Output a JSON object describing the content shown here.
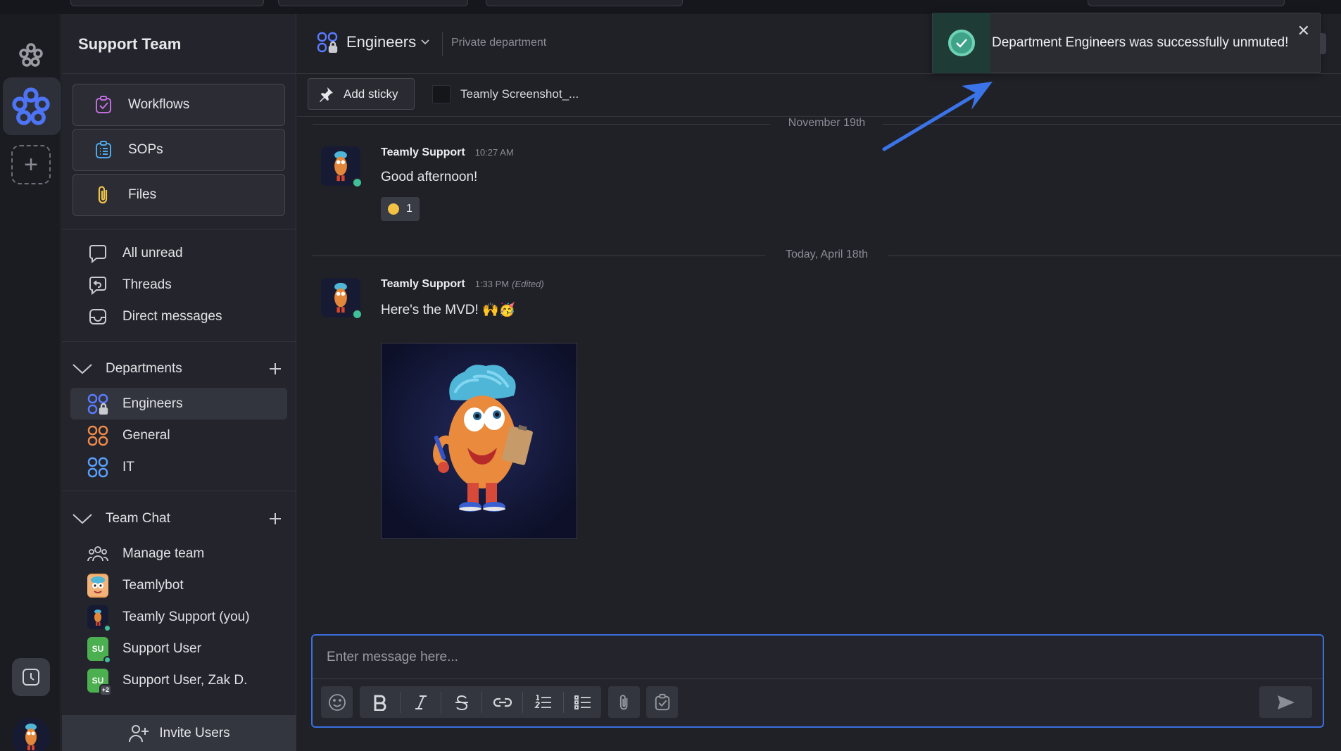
{
  "workspace": {
    "title": "Support Team"
  },
  "rail": {
    "logo_icon": "teamly-flower-icon",
    "active_icon": "teamly-flower-icon",
    "add_icon": "plus-icon",
    "clock_icon": "clock-icon"
  },
  "tools": [
    {
      "label": "Workflows",
      "icon": "workflow-check-icon",
      "color": "#c06ee0"
    },
    {
      "label": "SOPs",
      "icon": "clipboard-list-icon",
      "color": "#4fa8e8"
    },
    {
      "label": "Files",
      "icon": "paperclip-icon",
      "color": "#f2c34a"
    }
  ],
  "nav": {
    "all_unread": "All unread",
    "threads": "Threads",
    "direct_messages": "Direct messages"
  },
  "departments": {
    "header": "Departments",
    "items": [
      {
        "label": "Engineers",
        "color": "#5a7bff"
      },
      {
        "label": "General",
        "color": "#f08a4b"
      },
      {
        "label": "IT",
        "color": "#5aa0ff"
      }
    ]
  },
  "team_chat": {
    "header": "Team Chat",
    "items": [
      {
        "label": "Manage team"
      },
      {
        "label": "Teamlybot"
      },
      {
        "label": "Teamly Support (you)"
      },
      {
        "label": "Support User",
        "initials": "SU"
      },
      {
        "label": "Support User, Zak D.",
        "initials": "SU",
        "badge": "+2"
      }
    ]
  },
  "invite": {
    "label": "Invite Users"
  },
  "channel": {
    "name": "Engineers",
    "subtitle": "Private department"
  },
  "stickies": {
    "add_label": "Add sticky",
    "tab_label": "Teamly Screenshot_..."
  },
  "messages": {
    "day1": "November 19th",
    "day2": "Today, April 18th",
    "m1": {
      "author": "Teamly Support",
      "time": "10:27 AM",
      "text": "Good afternoon!",
      "reaction_count": "1"
    },
    "m2": {
      "author": "Teamly Support",
      "time": "1:33 PM",
      "edited": "(Edited)",
      "text": "Here's the MVD! 🙌🥳"
    }
  },
  "composer": {
    "placeholder": "Enter message here..."
  },
  "toast": {
    "text": "Department Engineers was successfully unmuted!",
    "close": "✕"
  },
  "colors": {
    "accent": "#3b6fdf",
    "online": "#3fbf9c",
    "success": "#3fa389"
  }
}
